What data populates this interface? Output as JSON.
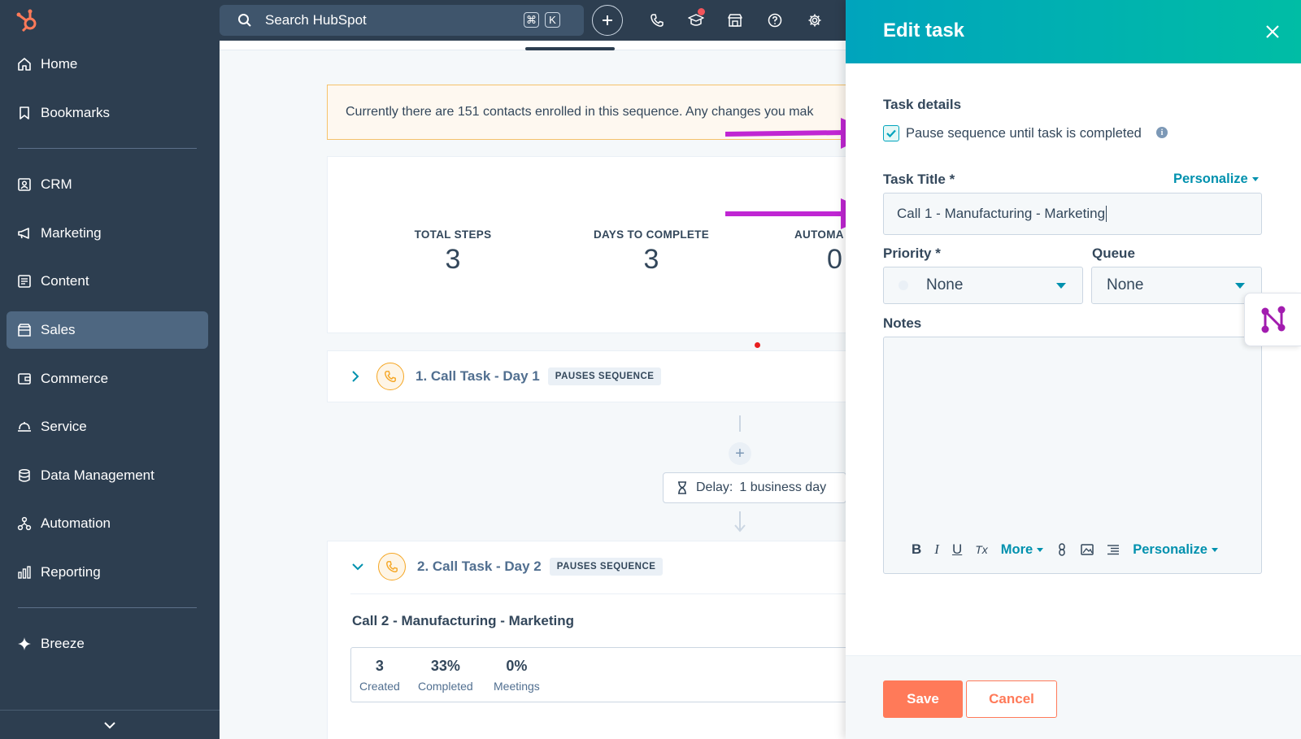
{
  "sidebar": {
    "items": [
      {
        "label": "Home",
        "icon": "home-icon"
      },
      {
        "label": "Bookmarks",
        "icon": "bookmark-icon"
      },
      {
        "label": "CRM",
        "icon": "contacts-icon"
      },
      {
        "label": "Marketing",
        "icon": "megaphone-icon"
      },
      {
        "label": "Content",
        "icon": "content-icon"
      },
      {
        "label": "Sales",
        "icon": "sales-icon"
      },
      {
        "label": "Commerce",
        "icon": "commerce-icon"
      },
      {
        "label": "Service",
        "icon": "service-icon"
      },
      {
        "label": "Data Management",
        "icon": "database-icon"
      },
      {
        "label": "Automation",
        "icon": "automation-icon"
      },
      {
        "label": "Reporting",
        "icon": "chart-icon"
      },
      {
        "label": "Breeze",
        "icon": "sparkle-icon"
      }
    ],
    "active_item": "Sales"
  },
  "topbar": {
    "search_placeholder": "Search HubSpot",
    "shortcut_keys": [
      "⌘",
      "K"
    ]
  },
  "alert": {
    "text": "Currently there are 151 contacts enrolled in this sequence. Any changes you mak"
  },
  "stats": [
    {
      "label": "TOTAL STEPS",
      "value": "3"
    },
    {
      "label": "DAYS TO COMPLETE",
      "value": "3"
    },
    {
      "label": "AUTOMA",
      "value": "0"
    }
  ],
  "steps": [
    {
      "title": "1. Call Task - Day 1",
      "badge": "PAUSES SEQUENCE"
    },
    {
      "title": "2. Call Task - Day 2",
      "badge": "PAUSES SEQUENCE",
      "task_name": "Call 2 - Manufacturing - Marketing",
      "metrics": [
        {
          "value": "3",
          "label": "Created"
        },
        {
          "value": "33%",
          "label": "Completed"
        },
        {
          "value": "0%",
          "label": "Meetings"
        }
      ]
    }
  ],
  "delay": {
    "label": "Delay:",
    "value": "1 business day"
  },
  "panel": {
    "title": "Edit task",
    "task_details_label": "Task details",
    "pause_checkbox_label": "Pause sequence until task is completed",
    "pause_checked": true,
    "task_title_label": "Task Title *",
    "personalize_label": "Personalize",
    "task_title_value": "Call 1 - Manufacturing - Marketing",
    "priority_label": "Priority *",
    "priority_value": "None",
    "queue_label": "Queue",
    "queue_value": "None",
    "notes_label": "Notes",
    "toolbar": {
      "bold": "B",
      "italic": "I",
      "underline": "U",
      "clear_format": "Tx",
      "more": "More",
      "personalize": "Personalize"
    },
    "save_label": "Save",
    "cancel_label": "Cancel"
  },
  "colors": {
    "sidebar_bg": "#2d3e50",
    "sidebar_active": "#4e6781",
    "panel_header_start": "#00a4bd",
    "panel_header_end": "#00bda5",
    "primary_button": "#ff7a59",
    "link": "#0091ae",
    "annotation_arrow": "#c026d3"
  }
}
